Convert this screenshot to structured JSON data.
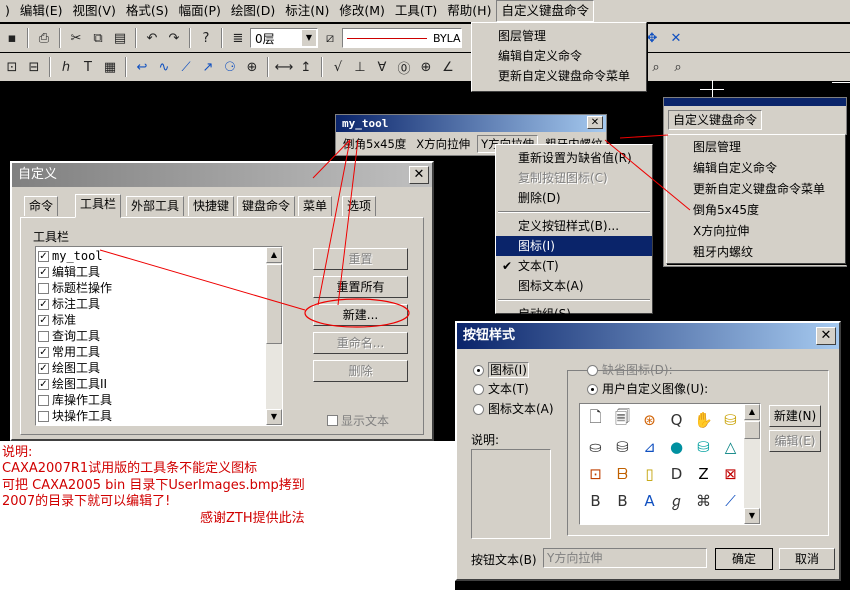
{
  "menubar": {
    "items": [
      "",
      ")",
      "编辑(E)",
      "视图(V)",
      "格式(S)",
      "幅面(P)",
      "绘图(D)",
      "标注(N)",
      "修改(M)",
      "工具(T)",
      "帮助(H)",
      "自定义键盘命令"
    ]
  },
  "toolbar": {
    "layer_value": "0层",
    "linetype_value": "BYLA"
  },
  "custom_menu1": {
    "items": [
      "图层管理",
      "编辑自定义命令",
      "更新自定义键盘命令菜单"
    ]
  },
  "custom_menu2": {
    "title": "自定义键盘命令",
    "items": [
      "图层管理",
      "编辑自定义命令",
      "更新自定义键盘命令菜单",
      "倒角5x45度",
      "X方向拉伸",
      "粗牙内螺纹"
    ]
  },
  "mytool": {
    "title": "my_tool",
    "buttons": [
      "倒角5x45度",
      "X方向拉伸",
      "Y方向拉伸",
      "粗牙内螺纹"
    ]
  },
  "context_menu": {
    "items": [
      "重新设置为缺省值(R)",
      "复制按钮图标(C)",
      "删除(D)",
      "定义按钮样式(B)...",
      "图标(I)",
      "文本(T)",
      "图标文本(A)",
      "启动组(S)"
    ],
    "checked": "✔"
  },
  "customize": {
    "title": "自定义",
    "tabs": [
      "命令",
      "工具栏",
      "外部工具",
      "快捷键",
      "键盘命令",
      "菜单",
      "选项"
    ],
    "group_label": "工具栏",
    "list": [
      {
        "label": "my_tool",
        "checked": true
      },
      {
        "label": "编辑工具",
        "checked": true
      },
      {
        "label": "标题栏操作",
        "checked": false
      },
      {
        "label": "标注工具",
        "checked": true
      },
      {
        "label": "标准",
        "checked": true
      },
      {
        "label": "查询工具",
        "checked": false
      },
      {
        "label": "常用工具",
        "checked": true
      },
      {
        "label": "绘图工具",
        "checked": true
      },
      {
        "label": "绘图工具II",
        "checked": true
      },
      {
        "label": "库操作工具",
        "checked": false
      },
      {
        "label": "块操作工具",
        "checked": false
      }
    ],
    "buttons": {
      "reset": "重置",
      "reset_all": "重置所有",
      "new": "新建...",
      "rename": "重命名...",
      "delete": "删除"
    },
    "show_text": "显示文本"
  },
  "note": {
    "line1": "说明:",
    "line2": "CAXA2007R1试用版的工具条不能定义图标",
    "line3": "可把 CAXA2005 bin 目录下UserImages.bmp拷到",
    "line4": "2007的目录下就可以编辑了!",
    "line5": "感谢ZTH提供此法"
  },
  "btnstyle": {
    "title": "按钮样式",
    "radios": [
      "图标(I)",
      "文本(T)",
      "图标文本(A)"
    ],
    "default_icon": "缺省图标(D):",
    "user_image": "用户自定义图像(U):",
    "desc_label": "说明:",
    "new_btn": "新建(N)",
    "edit_btn": "编辑(E)",
    "btn_text_label": "按钮文本(B)",
    "btn_text_value": "Y方向拉伸",
    "ok": "确定",
    "cancel": "取消"
  },
  "icons": [
    "🗋",
    "🗐",
    "⊛",
    "Q",
    "✋",
    "⛁",
    "⛀",
    "⛁",
    "⊿",
    "●",
    "⛁",
    "△",
    "⊡",
    "ᗷ",
    "▯",
    "D",
    "Z",
    "⊠",
    "B",
    "B",
    "A",
    "ℊ",
    "⌘",
    "⟋"
  ],
  "colors": {
    "accent": "#0a246a",
    "red_note": "#d00000",
    "canvas": "#000000",
    "face": "#d4d0c8"
  }
}
